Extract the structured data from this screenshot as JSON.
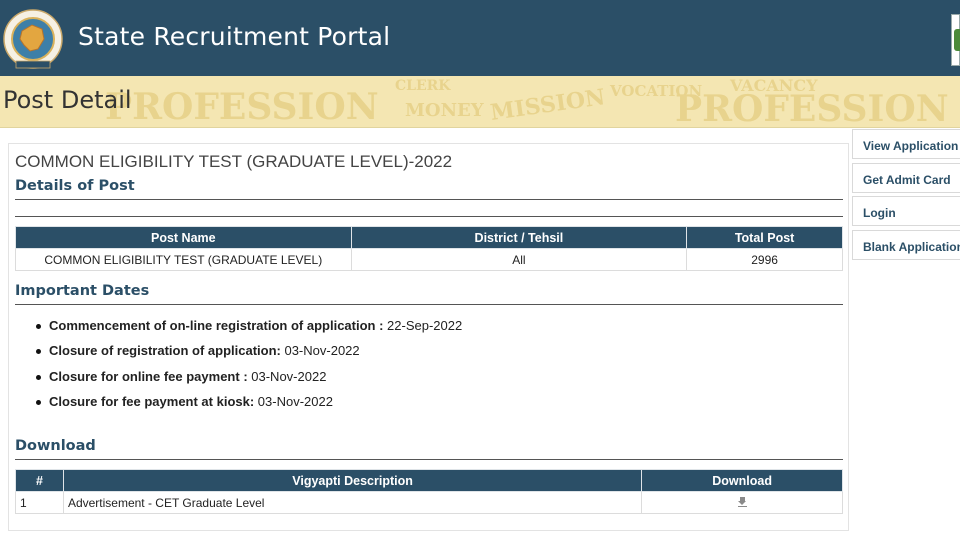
{
  "header": {
    "site_title": "State Recruitment Portal",
    "logo_icon": "rajasthan-emblem-icon"
  },
  "banner": {
    "heading": "Post Detail"
  },
  "post": {
    "exam_title": "COMMON ELIGIBILITY TEST (GRADUATE LEVEL)-2022",
    "details_heading": "Details of Post",
    "table": {
      "headers": [
        "Post Name",
        "District / Tehsil",
        "Total Post"
      ],
      "rows": [
        [
          "COMMON ELIGIBILITY TEST (GRADUATE LEVEL)",
          "All",
          "2996"
        ]
      ]
    }
  },
  "important_dates": {
    "heading": "Important Dates",
    "items": [
      {
        "label": "Commencement of on-line registration of application :",
        "value": " 22-Sep-2022"
      },
      {
        "label": "Closure of registration of application:",
        "value": " 03-Nov-2022"
      },
      {
        "label": "Closure for online fee payment :",
        "value": " 03-Nov-2022"
      },
      {
        "label": "Closure for fee payment at kiosk:",
        "value": " 03-Nov-2022"
      }
    ]
  },
  "download": {
    "heading": "Download",
    "headers": [
      "#",
      "Vigyapti Description",
      "Download"
    ],
    "rows": [
      {
        "num": "1",
        "description": "Advertisement - CET Graduate Level",
        "icon": "download-icon"
      }
    ]
  },
  "sidebar": {
    "items": [
      {
        "label": "View Application"
      },
      {
        "label": "Get Admit Card"
      },
      {
        "label": "Login"
      },
      {
        "label": "Blank Application"
      }
    ]
  },
  "colors": {
    "header_bg": "#2b4f67",
    "banner_bg": "#f4e6b2",
    "accent": "#2b4f67"
  }
}
